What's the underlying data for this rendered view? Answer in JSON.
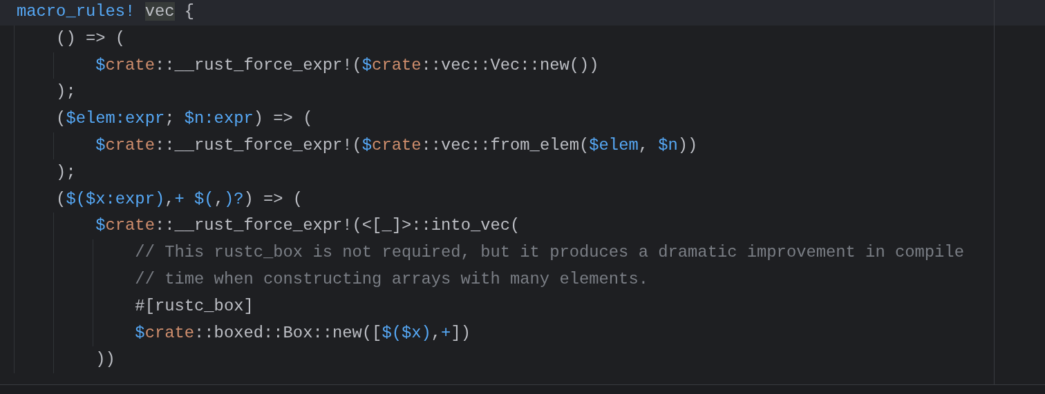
{
  "editor": {
    "lines": [
      {
        "current": true,
        "tokens": [
          {
            "kind": "keyword",
            "text": "macro_rules! "
          },
          {
            "kind": "highlight",
            "text": "vec"
          },
          {
            "kind": "plain",
            "text": " {"
          }
        ]
      },
      {
        "current": false,
        "tokens": [
          {
            "kind": "plain",
            "text": "    () => ("
          }
        ]
      },
      {
        "current": false,
        "tokens": [
          {
            "kind": "keyword",
            "text": "        $"
          },
          {
            "kind": "crate",
            "text": "crate"
          },
          {
            "kind": "plain",
            "text": "::__rust_force_expr!("
          },
          {
            "kind": "keyword",
            "text": "$"
          },
          {
            "kind": "crate",
            "text": "crate"
          },
          {
            "kind": "plain",
            "text": "::vec::Vec::new())"
          }
        ]
      },
      {
        "current": false,
        "tokens": [
          {
            "kind": "plain",
            "text": "    );"
          }
        ]
      },
      {
        "current": false,
        "tokens": [
          {
            "kind": "plain",
            "text": "    ("
          },
          {
            "kind": "keyword",
            "text": "$elem:expr"
          },
          {
            "kind": "plain",
            "text": "; "
          },
          {
            "kind": "keyword",
            "text": "$n:expr"
          },
          {
            "kind": "plain",
            "text": ") => ("
          }
        ]
      },
      {
        "current": false,
        "tokens": [
          {
            "kind": "keyword",
            "text": "        $"
          },
          {
            "kind": "crate",
            "text": "crate"
          },
          {
            "kind": "plain",
            "text": "::__rust_force_expr!("
          },
          {
            "kind": "keyword",
            "text": "$"
          },
          {
            "kind": "crate",
            "text": "crate"
          },
          {
            "kind": "plain",
            "text": "::vec::from_elem("
          },
          {
            "kind": "keyword",
            "text": "$elem"
          },
          {
            "kind": "plain",
            "text": ", "
          },
          {
            "kind": "keyword",
            "text": "$n"
          },
          {
            "kind": "plain",
            "text": "))"
          }
        ]
      },
      {
        "current": false,
        "tokens": [
          {
            "kind": "plain",
            "text": "    );"
          }
        ]
      },
      {
        "current": false,
        "tokens": [
          {
            "kind": "plain",
            "text": "    ("
          },
          {
            "kind": "keyword",
            "text": "$($x:expr)"
          },
          {
            "kind": "plain",
            "text": ","
          },
          {
            "kind": "keyword",
            "text": "+ $("
          },
          {
            "kind": "plain",
            "text": ","
          },
          {
            "kind": "keyword",
            "text": ")?"
          },
          {
            "kind": "plain",
            "text": ") => ("
          }
        ]
      },
      {
        "current": false,
        "tokens": [
          {
            "kind": "keyword",
            "text": "        $"
          },
          {
            "kind": "crate",
            "text": "crate"
          },
          {
            "kind": "plain",
            "text": "::__rust_force_expr!(<[_]>::into_vec("
          }
        ]
      },
      {
        "current": false,
        "tokens": [
          {
            "kind": "comment",
            "text": "            // This rustc_box is not required, but it produces a dramatic improvement in compile"
          }
        ]
      },
      {
        "current": false,
        "tokens": [
          {
            "kind": "comment",
            "text": "            // time when constructing arrays with many elements."
          }
        ]
      },
      {
        "current": false,
        "tokens": [
          {
            "kind": "plain",
            "text": "            #[rustc_box]"
          }
        ]
      },
      {
        "current": false,
        "tokens": [
          {
            "kind": "keyword",
            "text": "            $"
          },
          {
            "kind": "crate",
            "text": "crate"
          },
          {
            "kind": "plain",
            "text": "::boxed::Box::new(["
          },
          {
            "kind": "keyword",
            "text": "$($x)"
          },
          {
            "kind": "plain",
            "text": ","
          },
          {
            "kind": "keyword",
            "text": "+"
          },
          {
            "kind": "plain",
            "text": "])"
          }
        ]
      },
      {
        "current": false,
        "tokens": [
          {
            "kind": "plain",
            "text": "        ))"
          }
        ]
      }
    ]
  }
}
